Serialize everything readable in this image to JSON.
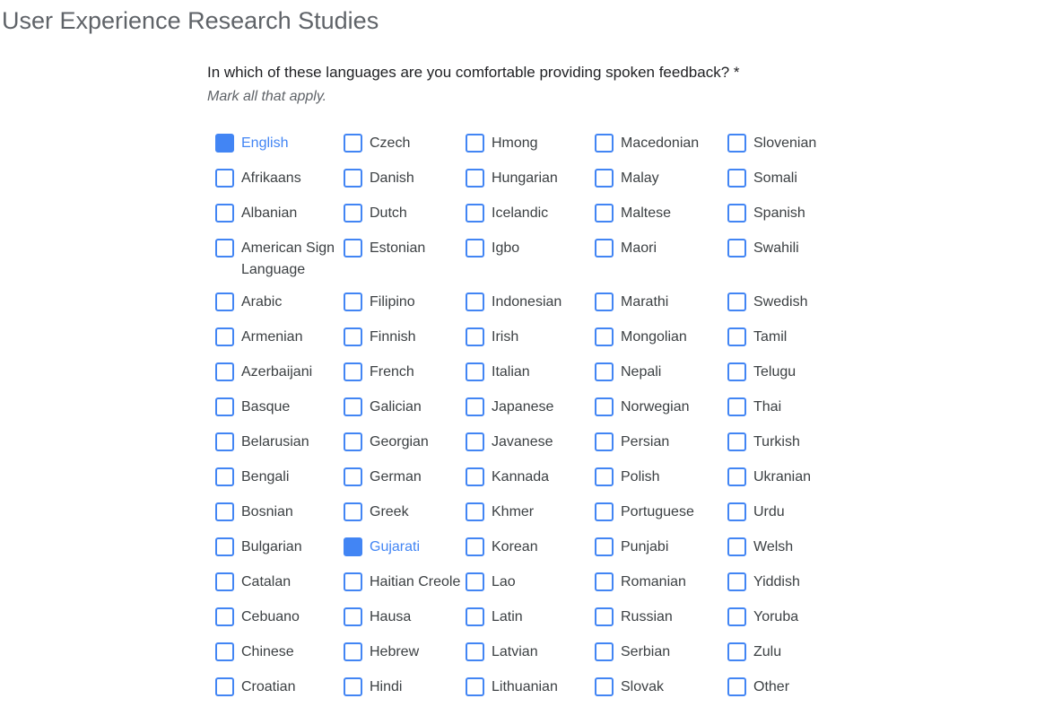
{
  "page": {
    "title": "User Experience Research Studies"
  },
  "question": {
    "text": "In which of these languages are you comfortable providing spoken feedback? *",
    "hint": "Mark all that apply."
  },
  "options": [
    [
      "English",
      "Czech",
      "Hmong",
      "Macedonian",
      "Slovenian"
    ],
    [
      "Afrikaans",
      "Danish",
      "Hungarian",
      "Malay",
      "Somali"
    ],
    [
      "Albanian",
      "Dutch",
      "Icelandic",
      "Maltese",
      "Spanish"
    ],
    [
      "American Sign Language",
      "Estonian",
      "Igbo",
      "Maori",
      "Swahili"
    ],
    [
      "Arabic",
      "Filipino",
      "Indonesian",
      "Marathi",
      "Swedish"
    ],
    [
      "Armenian",
      "Finnish",
      "Irish",
      "Mongolian",
      "Tamil"
    ],
    [
      "Azerbaijani",
      "French",
      "Italian",
      "Nepali",
      "Telugu"
    ],
    [
      "Basque",
      "Galician",
      "Japanese",
      "Norwegian",
      "Thai"
    ],
    [
      "Belarusian",
      "Georgian",
      "Javanese",
      "Persian",
      "Turkish"
    ],
    [
      "Bengali",
      "German",
      "Kannada",
      "Polish",
      "Ukranian"
    ],
    [
      "Bosnian",
      "Greek",
      "Khmer",
      "Portuguese",
      "Urdu"
    ],
    [
      "Bulgarian",
      "Gujarati",
      "Korean",
      "Punjabi",
      "Welsh"
    ],
    [
      "Catalan",
      "Haitian Creole",
      "Lao",
      "Romanian",
      "Yiddish"
    ],
    [
      "Cebuano",
      "Hausa",
      "Latin",
      "Russian",
      "Yoruba"
    ],
    [
      "Chinese",
      "Hebrew",
      "Latvian",
      "Serbian",
      "Zulu"
    ],
    [
      "Croatian",
      "Hindi",
      "Lithuanian",
      "Slovak",
      "Other"
    ]
  ],
  "checked": [
    "English",
    "Gujarati"
  ],
  "colors": {
    "accent": "#4285f4"
  }
}
